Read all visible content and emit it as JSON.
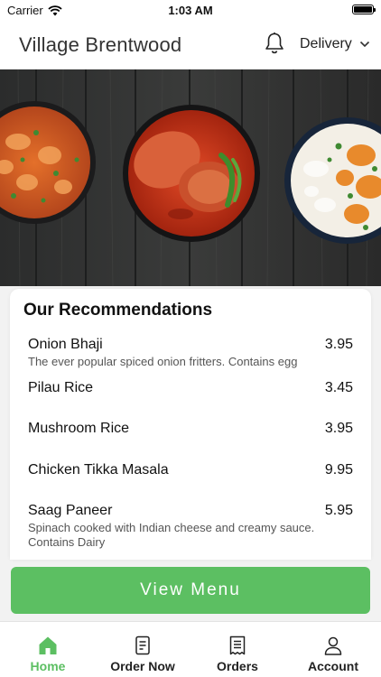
{
  "status_bar": {
    "carrier": "Carrier",
    "time": "1:03 AM"
  },
  "header": {
    "title": "Village Brentwood",
    "delivery_label": "Delivery"
  },
  "recommendations": {
    "title": "Our Recommendations",
    "items": [
      {
        "name": "Onion Bhaji",
        "price": "3.95",
        "description": "The ever popular spiced onion fritters. Contains egg"
      },
      {
        "name": "Pilau Rice",
        "price": "3.45",
        "description": ""
      },
      {
        "name": "Mushroom Rice",
        "price": "3.95",
        "description": ""
      },
      {
        "name": "Chicken Tikka Masala",
        "price": "9.95",
        "description": ""
      },
      {
        "name": "Saag Paneer",
        "price": "5.95",
        "description": "Spinach cooked with Indian cheese and creamy sauce. Contains Dairy"
      }
    ]
  },
  "view_menu_label": "View Menu",
  "tabs": [
    {
      "label": "Home",
      "icon": "home-icon",
      "active": true
    },
    {
      "label": "Order Now",
      "icon": "order-icon",
      "active": false
    },
    {
      "label": "Orders",
      "icon": "receipt-icon",
      "active": false
    },
    {
      "label": "Account",
      "icon": "account-icon",
      "active": false
    }
  ],
  "colors": {
    "accent": "#5cbf62",
    "header_bg": "#ffffff",
    "page_bg": "#f2f2f2"
  }
}
